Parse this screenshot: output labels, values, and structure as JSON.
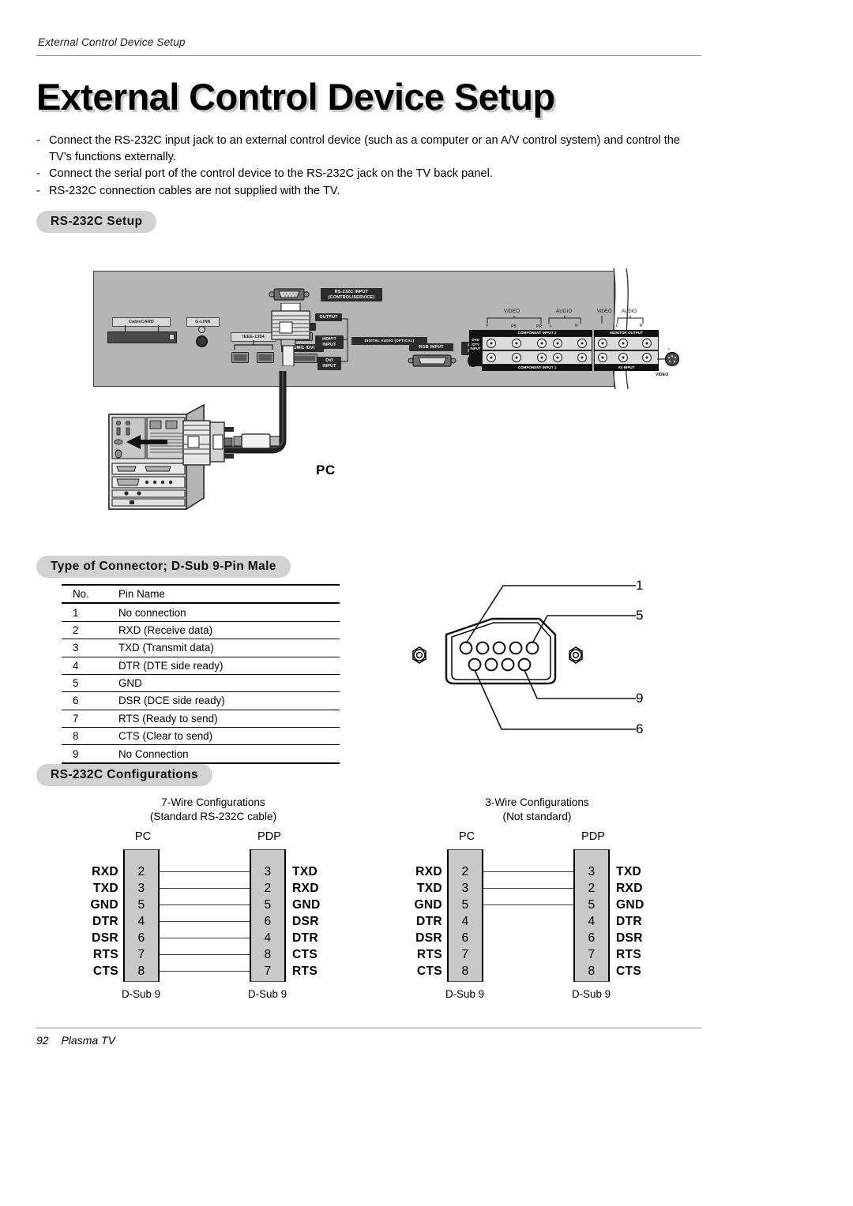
{
  "running_head": "External Control Device Setup",
  "title": "External Control Device Setup",
  "bullets": [
    {
      "dash": "-",
      "text": "Connect the RS-232C input jack to an external control device (such as a computer or an A/V control system) and control the TV’s functions externally."
    },
    {
      "dash": "-",
      "text": "Connect the serial port of the control device to the RS-232C jack on the TV back panel."
    },
    {
      "dash": "-",
      "text": "RS-232C connection cables are not supplied with the TV."
    }
  ],
  "sections": {
    "setup_heading": "RS-232C Setup",
    "connector_heading": "Type of Connector; D-Sub 9-Pin Male",
    "configurations_heading": "RS-232C Configurations"
  },
  "back_panel": {
    "labels": {
      "cablecard": "CableCARD",
      "glink": "G-LINK",
      "ieee1394": "IEEE-1394",
      "hdmi2": "HDMI 2",
      "hdmi1_dvi": "HDMI1 /DVI",
      "rs232c": "RS-232C INPUT\n(CONTROL/SERVICE)",
      "rs232c_line1": "RS-232C INPUT",
      "rs232c_line2": "(CONTROL/SERVICE)",
      "output": "OUTPUT",
      "hdmi3_input_line1": "HDMI3",
      "hdmi3_input_line2": "INPUT",
      "digital_audio_optical": "DIGITAL AUDIO (OPTICAL)",
      "dvi_input_line1": "DVI",
      "dvi_input_line2": "INPUT",
      "rgb_input": "RGB INPUT",
      "audio_input_line1": "AUDIO",
      "audio_input_line2": "INPUT",
      "video": "VIDEO",
      "audio": "AUDIO",
      "y": "Y",
      "pb": "PB",
      "pr": "PR",
      "left": "L",
      "right": "R",
      "component_input_2": "COMPONENT INPUT 2",
      "component_input_1": "COMPONENT INPUT 1",
      "monitor_output": "MONITOR OUTPUT",
      "av_input": "AV INPUT",
      "s_video": "S-VIDEO",
      "dvd_dtv_input_line1": "DVD",
      "dvd_dtv_input_line2": "/DTV",
      "dvd_dtv_input_line3": "INPUT"
    }
  },
  "pc_label": "PC",
  "pin_table": {
    "headers": [
      "No.",
      "Pin Name"
    ],
    "rows": [
      {
        "no": "1",
        "name": "No connection"
      },
      {
        "no": "2",
        "name": "RXD (Receive data)"
      },
      {
        "no": "3",
        "name": "TXD (Transmit data)"
      },
      {
        "no": "4",
        "name": "DTR (DTE side ready)"
      },
      {
        "no": "5",
        "name": "GND"
      },
      {
        "no": "6",
        "name": "DSR (DCE side ready)"
      },
      {
        "no": "7",
        "name": "RTS (Ready to send)"
      },
      {
        "no": "8",
        "name": "CTS (Clear to send)"
      },
      {
        "no": "9",
        "name": "No Connection"
      }
    ]
  },
  "dsub_callouts": {
    "top_left": "1",
    "top_right": "5",
    "bottom_right": "9",
    "bottom_left": "6"
  },
  "chart_data": {
    "type": "diagram",
    "title": "RS-232C Configurations",
    "diagrams": [
      {
        "title_line1": "7-Wire Configurations",
        "title_line2": "(Standard RS-232C cable)",
        "left_header": "PC",
        "right_header": "PDP",
        "left_footer": "D-Sub 9",
        "right_footer": "D-Sub 9",
        "left_pins": [
          {
            "signal": "RXD",
            "no": "2"
          },
          {
            "signal": "TXD",
            "no": "3"
          },
          {
            "signal": "GND",
            "no": "5"
          },
          {
            "signal": "DTR",
            "no": "4"
          },
          {
            "signal": "DSR",
            "no": "6"
          },
          {
            "signal": "RTS",
            "no": "7"
          },
          {
            "signal": "CTS",
            "no": "8"
          }
        ],
        "right_pins": [
          {
            "no": "3",
            "signal": "TXD"
          },
          {
            "no": "2",
            "signal": "RXD"
          },
          {
            "no": "5",
            "signal": "GND"
          },
          {
            "no": "6",
            "signal": "DSR"
          },
          {
            "no": "4",
            "signal": "DTR"
          },
          {
            "no": "8",
            "signal": "CTS"
          },
          {
            "no": "7",
            "signal": "RTS"
          }
        ],
        "connections": [
          0,
          1,
          2,
          3,
          4,
          5,
          6
        ]
      },
      {
        "title_line1": "3-Wire Configurations",
        "title_line2": "(Not standard)",
        "left_header": "PC",
        "right_header": "PDP",
        "left_footer": "D-Sub 9",
        "right_footer": "D-Sub 9",
        "left_pins": [
          {
            "signal": "RXD",
            "no": "2"
          },
          {
            "signal": "TXD",
            "no": "3"
          },
          {
            "signal": "GND",
            "no": "5"
          },
          {
            "signal": "DTR",
            "no": "4"
          },
          {
            "signal": "DSR",
            "no": "6"
          },
          {
            "signal": "RTS",
            "no": "7"
          },
          {
            "signal": "CTS",
            "no": "8"
          }
        ],
        "right_pins": [
          {
            "no": "3",
            "signal": "TXD"
          },
          {
            "no": "2",
            "signal": "RXD"
          },
          {
            "no": "5",
            "signal": "GND"
          },
          {
            "no": "4",
            "signal": "DTR"
          },
          {
            "no": "6",
            "signal": "DSR"
          },
          {
            "no": "7",
            "signal": "RTS"
          },
          {
            "no": "8",
            "signal": "CTS"
          }
        ],
        "connections": [
          0,
          1,
          2
        ]
      }
    ]
  },
  "footer": {
    "page": "92",
    "product": "Plasma TV"
  },
  "colors": {
    "pill_gray": "#d2d2d2",
    "panel_gray": "#b5b5b5",
    "connector_gray": "#c9c9c9",
    "rule_gray": "#8c8c8c"
  }
}
